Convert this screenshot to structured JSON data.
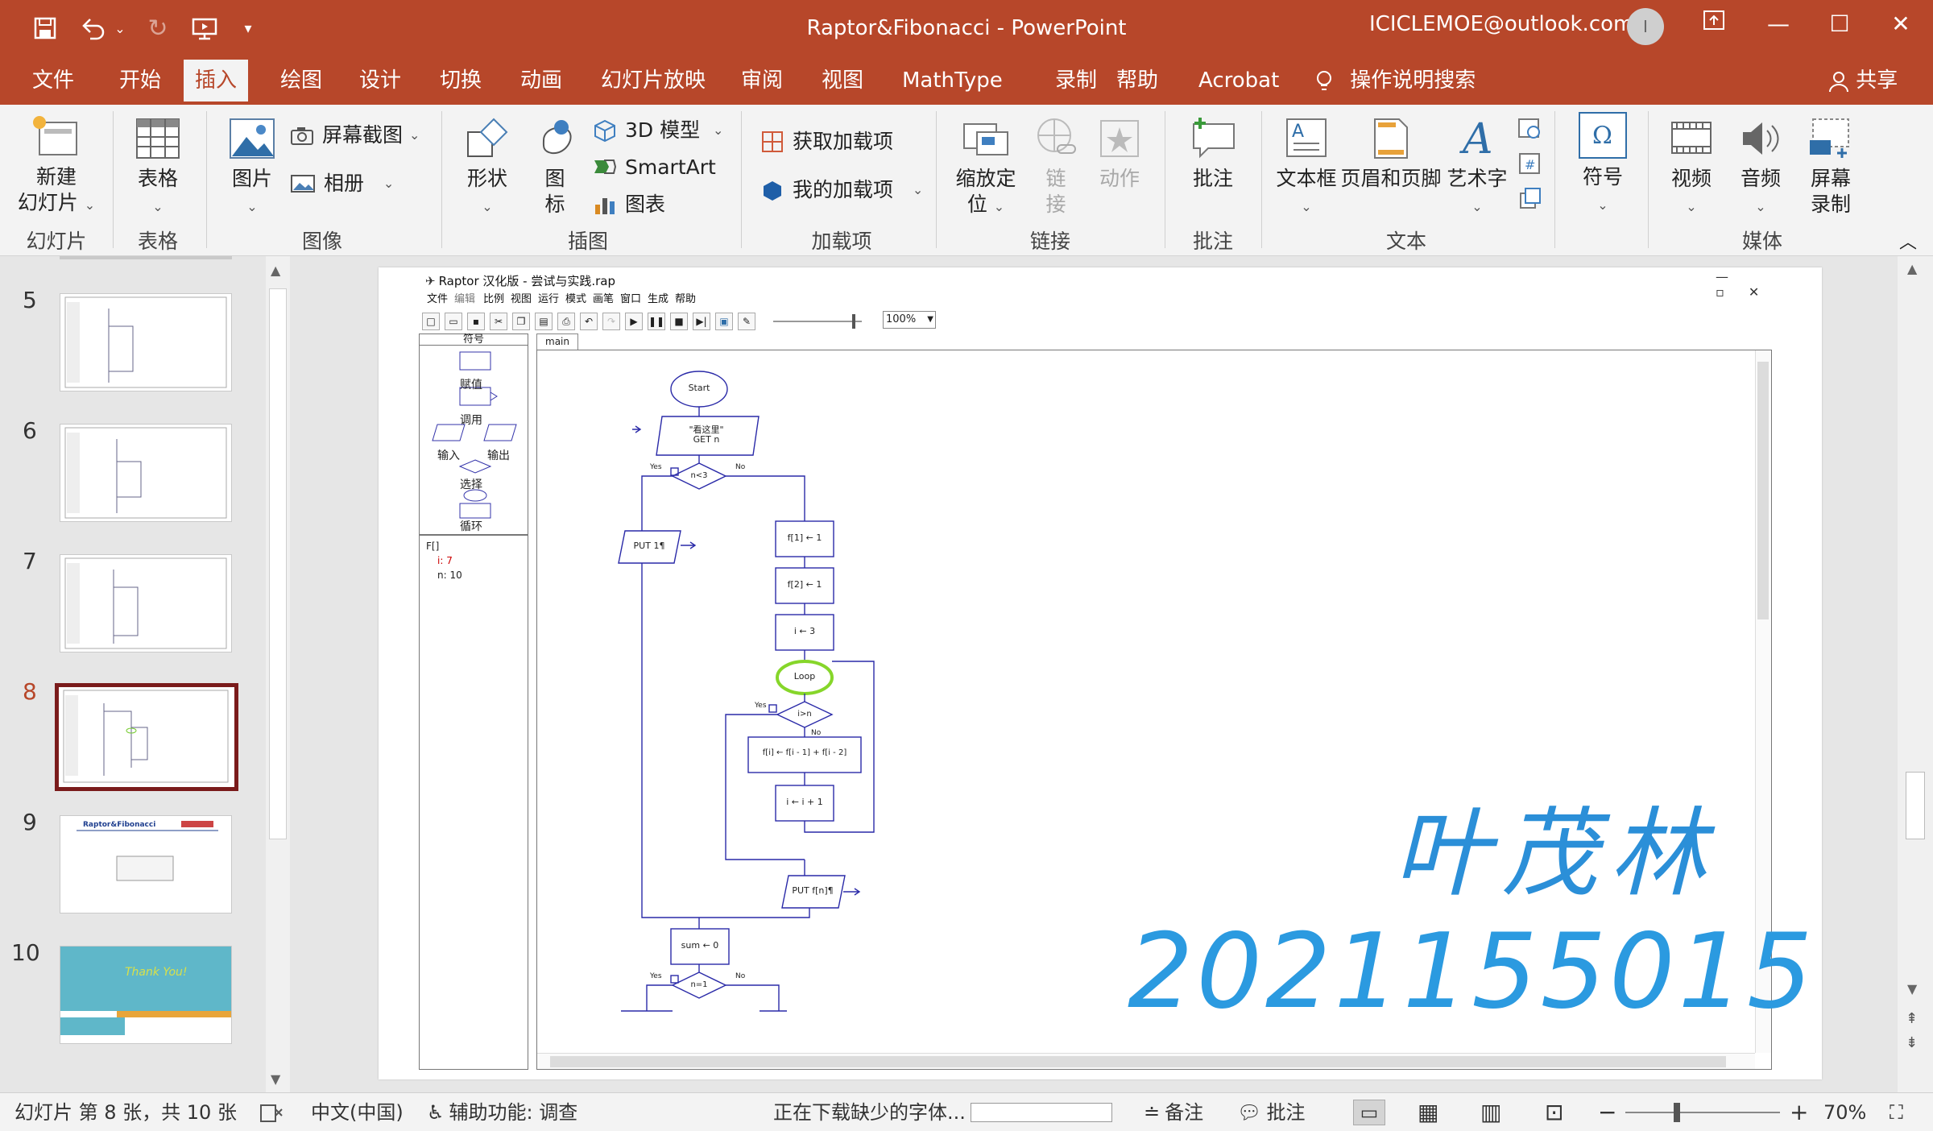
{
  "titlebar": {
    "title": "Raptor&Fibonacci  -  PowerPoint",
    "account": "ICICLEMOE@outlook.com",
    "avatar_initial": "I"
  },
  "tabs": [
    "文件",
    "开始",
    "插入",
    "绘图",
    "设计",
    "切换",
    "动画",
    "幻灯片放映",
    "审阅",
    "视图",
    "MathType",
    "录制",
    "帮助",
    "Acrobat"
  ],
  "active_tab": "插入",
  "tell_me": "操作说明搜索",
  "share": "共享",
  "ribbon": {
    "slides": {
      "new_slide_1": "新建",
      "new_slide_2": "幻灯片",
      "group": "幻灯片"
    },
    "tables": {
      "table": "表格",
      "group": "表格"
    },
    "images": {
      "picture": "图片",
      "screenshot": "屏幕截图",
      "album": "相册",
      "group": "图像"
    },
    "illustrations": {
      "shapes": "形状",
      "icons_1": "图",
      "icons_2": "标",
      "model3d": "3D 模型",
      "smartart": "SmartArt",
      "chart": "图表",
      "group": "插图"
    },
    "addins": {
      "get": "获取加载项",
      "mine": "我的加载项",
      "group": "加载项"
    },
    "links": {
      "zoom_1": "缩放定",
      "zoom_2": "位",
      "link_1": "链",
      "link_2": "接",
      "action": "动作",
      "group": "链接"
    },
    "comments": {
      "comment": "批注",
      "group": "批注"
    },
    "text": {
      "textbox": "文本框",
      "header_footer": "页眉和页脚",
      "wordart": "艺术字",
      "group": "文本"
    },
    "symbols": {
      "symbol": "符号"
    },
    "media": {
      "video": "视频",
      "audio": "音频",
      "screen_rec_1": "屏幕",
      "screen_rec_2": "录制",
      "group": "媒体"
    }
  },
  "thumbnails": [
    {
      "num": "5"
    },
    {
      "num": "6"
    },
    {
      "num": "7"
    },
    {
      "num": "8"
    },
    {
      "num": "9",
      "title": "Raptor&Fibonacci"
    },
    {
      "num": "10",
      "text": "Thank You!"
    }
  ],
  "active_slide": "8",
  "raptor": {
    "title": "Raptor 汉化版 - 尝试与实践.rap",
    "menu": [
      "文件",
      "编辑",
      "比例",
      "视图",
      "运行",
      "模式",
      "画笔",
      "窗口",
      "生成",
      "帮助"
    ],
    "zoom": "100%",
    "symbols_title": "符号",
    "symbols": [
      "赋值",
      "调用",
      "输入",
      "输出",
      "选择",
      "循环"
    ],
    "vars": [
      "F[]",
      "i: 7",
      "n: 10"
    ],
    "tab": "main",
    "flow": {
      "start": "Start",
      "input_prompt": "\"看这里\"",
      "input_var": "GET n",
      "cond1": "n<3",
      "yes": "Yes",
      "no": "No",
      "put1": "PUT 1¶",
      "a1": "f[1] ← 1",
      "a2": "f[2] ← 1",
      "a3": "i ← 3",
      "loop": "Loop",
      "cond2": "i>n",
      "a4": "f[i] ← f[i - 1] + f[i - 2]",
      "a5": "i ← i + 1",
      "put2": "PUT f[n]¶",
      "sum": "sum ← 0",
      "cond3": "n=1"
    }
  },
  "signature": {
    "name": "叶茂林",
    "id": "2021155015"
  },
  "status": {
    "slide_info": "幻灯片 第 8 张，共 10 张",
    "language": "中文(中国)",
    "accessibility": "辅助功能: 调查",
    "downloading": "正在下载缺少的字体...",
    "notes": "备注",
    "comments": "批注",
    "zoom": "70%"
  }
}
